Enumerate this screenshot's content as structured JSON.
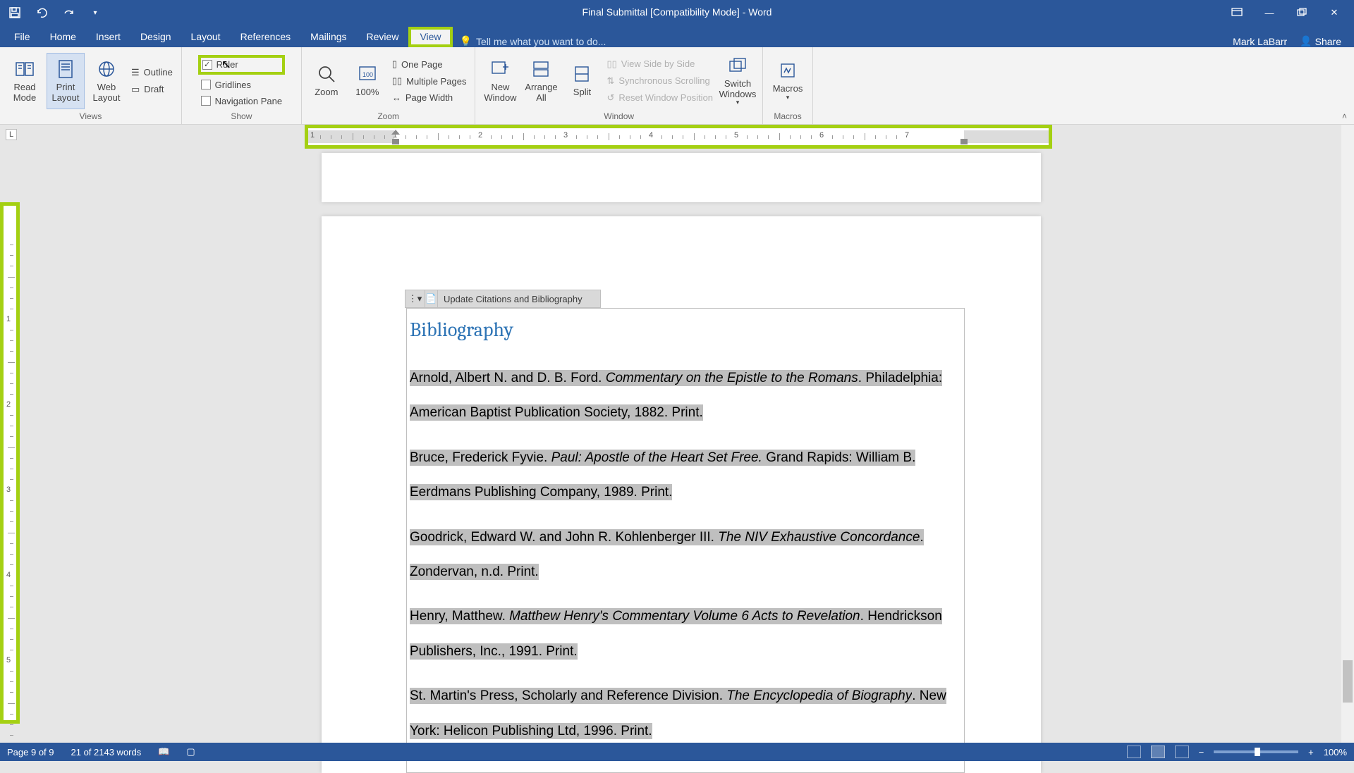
{
  "title": "Final Submittal [Compatibility Mode] - Word",
  "user": "Mark LaBarr",
  "share": "Share",
  "tabs": {
    "file": "File",
    "home": "Home",
    "insert": "Insert",
    "design": "Design",
    "layout": "Layout",
    "references": "References",
    "mailings": "Mailings",
    "review": "Review",
    "view": "View",
    "tellme": "Tell me what you want to do..."
  },
  "ribbon": {
    "views": {
      "label": "Views",
      "read": "Read Mode",
      "print": "Print Layout",
      "web": "Web Layout",
      "outline": "Outline",
      "draft": "Draft"
    },
    "show": {
      "label": "Show",
      "ruler": "Ruler",
      "gridlines": "Gridlines",
      "navpane": "Navigation Pane"
    },
    "zoom": {
      "label": "Zoom",
      "zoom": "Zoom",
      "hundred": "100%",
      "onepage": "One Page",
      "multi": "Multiple Pages",
      "pagewidth": "Page Width"
    },
    "window": {
      "label": "Window",
      "neww": "New Window",
      "arrange": "Arrange All",
      "split": "Split",
      "sbs": "View Side by Side",
      "sync": "Synchronous Scrolling",
      "reset": "Reset Window Position",
      "switch": "Switch Windows"
    },
    "macros": {
      "label": "Macros",
      "macros": "Macros"
    }
  },
  "ruler": {
    "h_numbers": [
      "1",
      "1",
      "2",
      "3",
      "4",
      "5",
      "6",
      "7"
    ],
    "v_numbers": [
      "1",
      "2",
      "3",
      "4",
      "5"
    ]
  },
  "field": {
    "update": "Update Citations and Bibliography"
  },
  "doc": {
    "heading": "Bibliography",
    "entries": [
      {
        "pre": "Arnold, Albert N. and D. B. Ford. ",
        "it": "Commentary on the Epistle to the Romans",
        "post": ". Philadelphia: American Baptist Publication Society, 1882. Print."
      },
      {
        "pre": "Bruce, Frederick Fyvie. ",
        "it": "Paul: Apostle of the Heart Set Free.",
        "post": " Grand Rapids: William B. Eerdmans Publishing Company, 1989. Print."
      },
      {
        "pre": "Goodrick, Edward W. and John R. Kohlenberger III. ",
        "it": "The NIV Exhaustive Concordance",
        "post": ". Zondervan, n.d. Print."
      },
      {
        "pre": "Henry, Matthew. ",
        "it": "Matthew Henry's Commentary Volume 6 Acts to Revelation",
        "post": ". Hendrickson Publishers, Inc., 1991. Print."
      },
      {
        "pre": "St. Martin's Press, Scholarly and Reference Division. ",
        "it": "The Encyclopedia of Biography",
        "post": ". New York: Helicon Publishing Ltd, 1996. Print."
      }
    ]
  },
  "status": {
    "page": "Page 9 of 9",
    "words": "21 of 2143 words",
    "zoom": "100%"
  }
}
